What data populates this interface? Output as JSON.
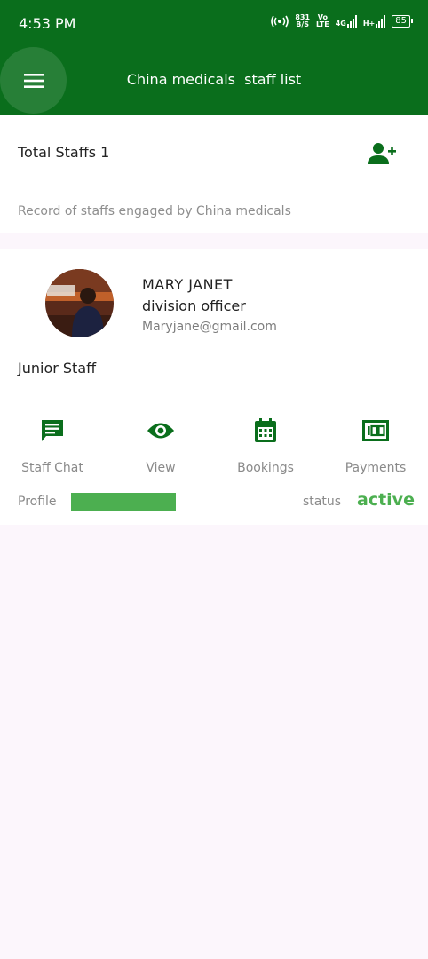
{
  "status_bar": {
    "time": "4:53 PM",
    "data_speed": "831",
    "data_unit": "B/S",
    "volte": "Vo",
    "volte_sub": "LTE",
    "network": "4G",
    "network2": "H+",
    "battery": "85"
  },
  "app_bar": {
    "title": "China medicals  staff list",
    "menu_icon": "menu-icon",
    "color": "#0a6e1c"
  },
  "summary": {
    "total_label": "Total Staffs 1",
    "add_icon": "person-add-icon",
    "subtitle": "Record of staffs engaged by China medicals"
  },
  "staff": [
    {
      "name": "MARY JANET",
      "role": "division officer",
      "email": "Maryjane@gmail.com",
      "level": "Junior Staff",
      "actions": [
        {
          "label": "Staff Chat",
          "icon": "chat-icon"
        },
        {
          "label": "View",
          "icon": "eye-icon"
        },
        {
          "label": "Bookings",
          "icon": "calendar-icon"
        },
        {
          "label": "Payments",
          "icon": "money-icon"
        }
      ],
      "profile_label": "Profile",
      "profile_progress": 1.0,
      "status_label": "status",
      "status_value": "active"
    }
  ],
  "colors": {
    "primary": "#0a6e1c",
    "progress": "#4caf50",
    "active": "#4caf50",
    "background": "#fcf6fc"
  }
}
